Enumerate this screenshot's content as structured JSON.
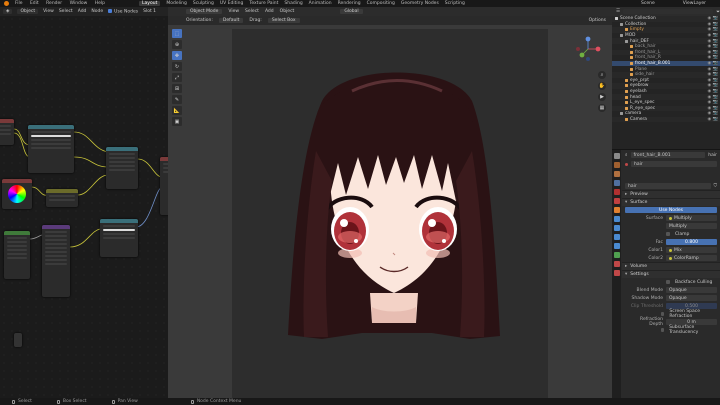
{
  "topbar": {
    "menu": [
      "File",
      "Edit",
      "Render",
      "Window",
      "Help"
    ],
    "tabs": [
      "Layout",
      "Modeling",
      "Sculpting",
      "UV Editing",
      "Texture Paint",
      "Shading",
      "Animation",
      "Rendering",
      "Compositing",
      "Geometry Nodes",
      "Scripting"
    ],
    "active_tab": "Layout",
    "scene": "Scene",
    "view_layer": "ViewLayer"
  },
  "node_editor": {
    "mode": "Object",
    "menus": [
      "View",
      "Select",
      "Add",
      "Node"
    ],
    "use_nodes": "Use Nodes",
    "slot": "Slot 1"
  },
  "viewport": {
    "orientation_label": "Orientation:",
    "orientation": "Default",
    "drag_label": "Drag:",
    "drag": "Select Box",
    "mode": "Object Mode",
    "menus": [
      "View",
      "Select",
      "Add",
      "Object"
    ],
    "transform": "Global",
    "options": "Options"
  },
  "outliner": {
    "items": [
      {
        "label": "Scene Collection",
        "indent": 0,
        "color": "#cfcfcf"
      },
      {
        "label": "Collection",
        "indent": 1,
        "color": "#cfcfcf"
      },
      {
        "label": "Empty",
        "indent": 2,
        "color": "#e0a050"
      },
      {
        "label": "MOD",
        "indent": 1,
        "color": "#cfcfcf"
      },
      {
        "label": "hair_DEF",
        "indent": 2,
        "color": "#cfcfcf"
      },
      {
        "label": "back_hair",
        "indent": 3,
        "color": "#9a9a9a"
      },
      {
        "label": "front_hair_L",
        "indent": 3,
        "color": "#9a9a9a"
      },
      {
        "label": "front_hair_R",
        "indent": 3,
        "color": "#9a9a9a"
      },
      {
        "label": "front_hair_B.001",
        "indent": 3,
        "color": "#ffffff"
      },
      {
        "label": "Plane",
        "indent": 3,
        "color": "#9a9a9a"
      },
      {
        "label": "side_hair",
        "indent": 3,
        "color": "#9a9a9a"
      },
      {
        "label": "eye_prpt",
        "indent": 2,
        "color": "#cfcfcf"
      },
      {
        "label": "eyebrow",
        "indent": 2,
        "color": "#cfcfcf"
      },
      {
        "label": "eyelash",
        "indent": 2,
        "color": "#cfcfcf"
      },
      {
        "label": "head",
        "indent": 2,
        "color": "#cfcfcf"
      },
      {
        "label": "L_eye_spec",
        "indent": 2,
        "color": "#cfcfcf"
      },
      {
        "label": "R_eye_spec",
        "indent": 2,
        "color": "#cfcfcf"
      },
      {
        "label": "camera",
        "indent": 1,
        "color": "#cfcfcf"
      },
      {
        "label": "Camera",
        "indent": 2,
        "color": "#cfcfcf"
      }
    ]
  },
  "properties": {
    "object": "front_hair_B.001",
    "material_tab": "hair",
    "material_slot": "hair",
    "material_name": "hair",
    "preview": "Preview",
    "surface": "Surface",
    "use_nodes": "Use Nodes",
    "surface_label": "Surface",
    "surface_value": "Multiply",
    "blend_value": "Multiply",
    "clamp": "Clamp",
    "fac_label": "Fac",
    "fac_value": "0.800",
    "color1_label": "Color1",
    "color1_value": "Mix",
    "color2_label": "Color2",
    "color2_value": "ColorRamp",
    "volume": "Volume",
    "settings": "Settings",
    "backface_culling": "Backface Culling",
    "blend_mode_label": "Blend Mode",
    "blend_mode": "Opaque",
    "shadow_mode_label": "Shadow Mode",
    "shadow_mode": "Opaque",
    "clip_threshold_label": "Clip Threshold",
    "clip_threshold": "0.500",
    "ssr": "Screen Space Refraction",
    "refraction_depth_label": "Refraction Depth",
    "refraction_depth": "0 m",
    "subsurface": "Subsurface Translucency"
  },
  "footer": {
    "select": "Select",
    "box_select": "Box Select",
    "pan_view": "Pan View",
    "context_menu": "Node Context Menu"
  },
  "colors": {
    "accent": "#4772b3",
    "hair": "#2a1214",
    "skin": "#fbe6dc",
    "eye": "#b0323a"
  }
}
